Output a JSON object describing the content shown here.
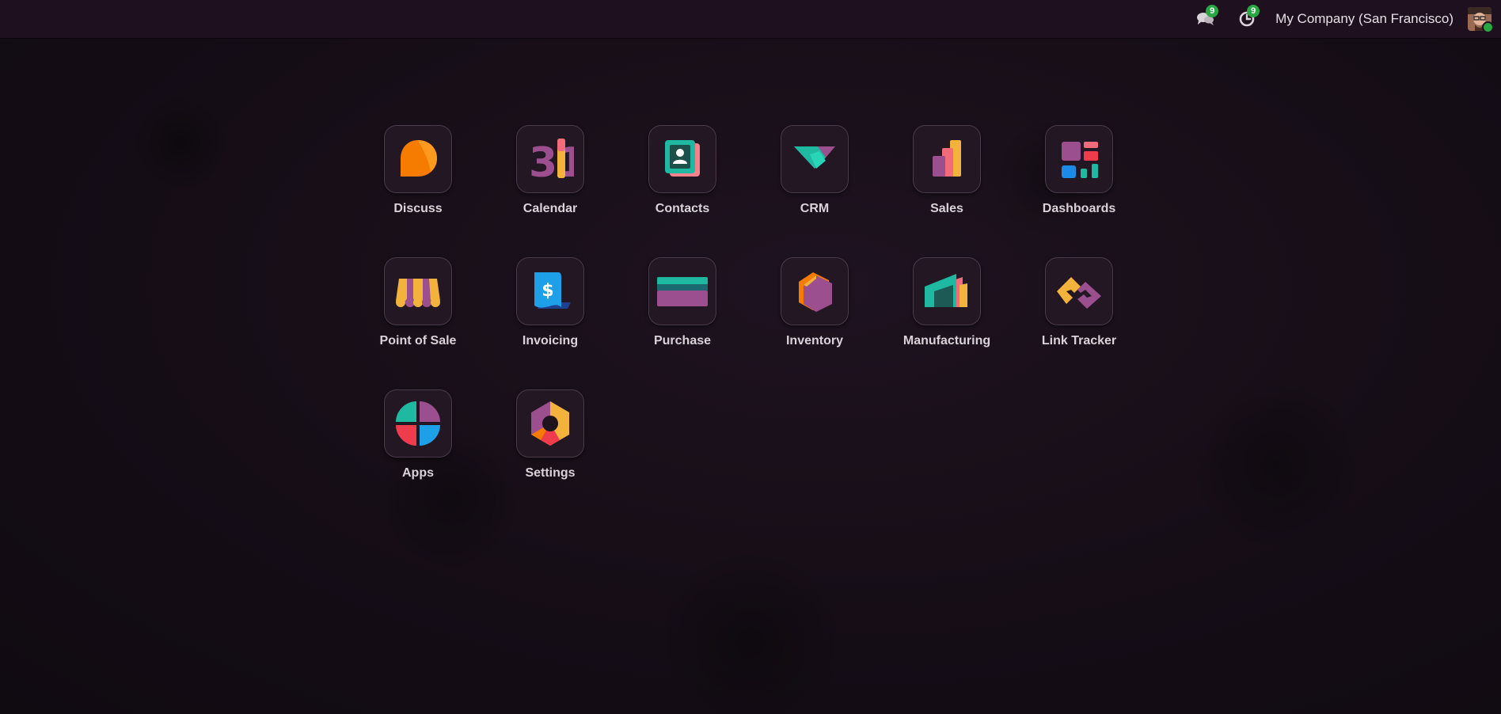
{
  "systray": {
    "messages_badge": "9",
    "activities_badge": "9",
    "company": "My Company (San Francisco)"
  },
  "apps": [
    {
      "label": "Discuss",
      "icon": "discuss-icon"
    },
    {
      "label": "Calendar",
      "icon": "calendar-icon",
      "icon_text": "31"
    },
    {
      "label": "Contacts",
      "icon": "contacts-icon"
    },
    {
      "label": "CRM",
      "icon": "crm-icon"
    },
    {
      "label": "Sales",
      "icon": "sales-icon"
    },
    {
      "label": "Dashboards",
      "icon": "dashboards-icon"
    },
    {
      "label": "Point of Sale",
      "icon": "point-of-sale-icon"
    },
    {
      "label": "Invoicing",
      "icon": "invoicing-icon",
      "icon_text": "$"
    },
    {
      "label": "Purchase",
      "icon": "purchase-icon"
    },
    {
      "label": "Inventory",
      "icon": "inventory-icon"
    },
    {
      "label": "Manufacturing",
      "icon": "manufacturing-icon"
    },
    {
      "label": "Link Tracker",
      "icon": "link-tracker-icon"
    },
    {
      "label": "Apps",
      "icon": "apps-icon"
    },
    {
      "label": "Settings",
      "icon": "settings-icon"
    }
  ],
  "colors": {
    "background": "#170e18",
    "topbar": "#1f1020",
    "badge": "#28a745",
    "tile": "#231723"
  }
}
